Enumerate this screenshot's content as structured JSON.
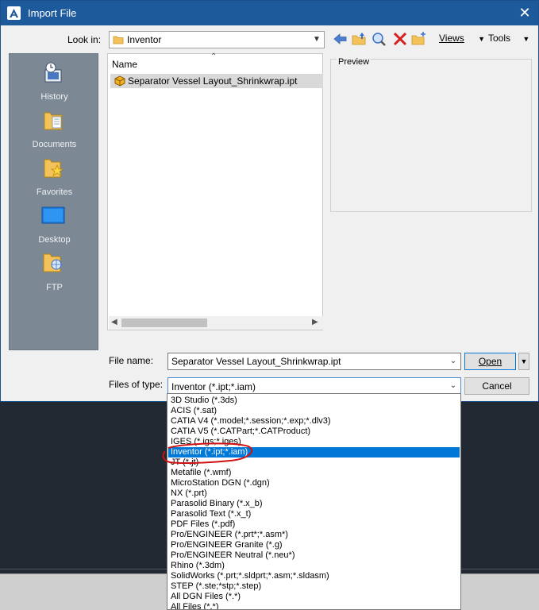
{
  "window": {
    "title": "Import File",
    "close_glyph": "✕",
    "app_icon": "autodesk-a-icon"
  },
  "toolbar": {
    "look_in_label": "Look in:",
    "look_in_value": "Inventor",
    "views_label": "Views",
    "tools_label": "Tools",
    "icons": [
      "back-arrow-icon",
      "up-folder-icon",
      "search-web-icon",
      "delete-icon",
      "new-folder-icon"
    ]
  },
  "places": [
    {
      "label": "History",
      "icon": "history-icon"
    },
    {
      "label": "Documents",
      "icon": "documents-icon"
    },
    {
      "label": "Favorites",
      "icon": "favorites-icon"
    },
    {
      "label": "Desktop",
      "icon": "desktop-icon"
    },
    {
      "label": "FTP",
      "icon": "ftp-icon"
    }
  ],
  "file_list": {
    "column_name": "Name",
    "files": [
      {
        "name": "Separator Vessel Layout_Shrinkwrap.ipt",
        "icon": "inventor-part-icon",
        "selected": true
      }
    ]
  },
  "preview": {
    "label": "Preview"
  },
  "form": {
    "file_name_label": "File name:",
    "file_name_value": "Separator Vessel Layout_Shrinkwrap.ipt",
    "files_of_type_label": "Files of type:",
    "files_of_type_value": "Inventor (*.ipt;*.iam)",
    "open_label": "Open",
    "cancel_label": "Cancel"
  },
  "file_types": [
    "3D Studio (*.3ds)",
    "ACIS (*.sat)",
    "CATIA V4 (*.model;*.session;*.exp;*.dlv3)",
    "CATIA V5 (*.CATPart;*.CATProduct)",
    "IGES (*.igs;*.iges)",
    "Inventor (*.ipt;*.iam)",
    "JT (*.jt)",
    "Metafile (*.wmf)",
    "MicroStation DGN (*.dgn)",
    "NX (*.prt)",
    "Parasolid Binary (*.x_b)",
    "Parasolid Text (*.x_t)",
    "PDF Files (*.pdf)",
    "Pro/ENGINEER (*.prt*;*.asm*)",
    "Pro/ENGINEER Granite (*.g)",
    "Pro/ENGINEER Neutral (*.neu*)",
    "Rhino (*.3dm)",
    "SolidWorks (*.prt;*.sldprt;*.asm;*.sldasm)",
    "STEP (*.ste;*stp;*.step)",
    "All DGN Files (*.*)",
    "All Files (*.*)"
  ],
  "selected_type_index": 5,
  "colors": {
    "titlebar": "#1d5a9c",
    "selection": "#0078d7",
    "places_bar": "#7d8895",
    "annotation": "#d01010"
  }
}
